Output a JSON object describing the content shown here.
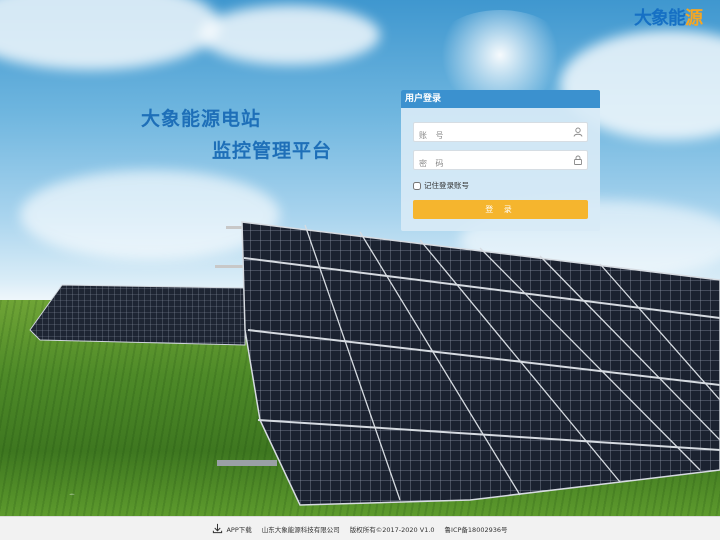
{
  "brand": {
    "name_main": "大象能",
    "name_tail": "源"
  },
  "hero": {
    "line1": "大象能源电站",
    "line2": "监控管理平台"
  },
  "login": {
    "title": "用户登录",
    "username_placeholder": "账 号",
    "password_placeholder": "密 码",
    "remember_label": "记住登录账号",
    "submit_label": "登 录"
  },
  "footer": {
    "app_download": "APP下载",
    "company": "山东大象能源科技有限公司",
    "copyright": "版权所有©2017-2020 V1.0",
    "icp": "鲁ICP备18002936号"
  },
  "colors": {
    "accent": "#3b91cf",
    "button": "#f5b52e",
    "hero_text": "#1e6fb8",
    "brand": "#1670c4"
  }
}
